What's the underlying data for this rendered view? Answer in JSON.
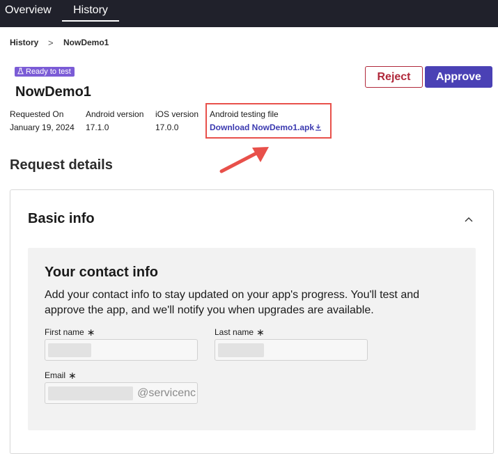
{
  "nav": {
    "tabs": [
      {
        "label": "Overview"
      },
      {
        "label": "History"
      }
    ]
  },
  "breadcrumb": {
    "root": "History",
    "separator": ">",
    "current": "NowDemo1"
  },
  "status_badge": {
    "label": "Ready to test",
    "color": "#7b5cd6"
  },
  "app": {
    "name": "NowDemo1"
  },
  "actions": {
    "reject_label": "Reject",
    "approve_label": "Approve"
  },
  "meta": {
    "requested_on": {
      "label": "Requested On",
      "value": "January 19, 2024"
    },
    "android_version": {
      "label": "Android version",
      "value": "17.1.0"
    },
    "ios_version": {
      "label": "iOS version",
      "value": "17.0.0"
    },
    "android_file": {
      "label": "Android testing file",
      "link_text": "Download NowDemo1.apk"
    }
  },
  "request_details": {
    "title": "Request details"
  },
  "basic_info": {
    "title": "Basic info",
    "contact": {
      "title": "Your contact info",
      "description": "Add your contact info to stay updated on your app's progress. You'll test and approve the app, and we'll notify you when upgrades are available.",
      "fields": {
        "first_name": {
          "label": "First name",
          "required_mark": "∗"
        },
        "last_name": {
          "label": "Last name",
          "required_mark": "∗"
        },
        "email": {
          "label": "Email",
          "required_mark": "∗",
          "visible_suffix": "@servicenc"
        }
      }
    }
  },
  "colors": {
    "topbar": "#20212b",
    "accent": "#4a41b5",
    "reject": "#b0283a",
    "highlight": "#e8504a"
  }
}
